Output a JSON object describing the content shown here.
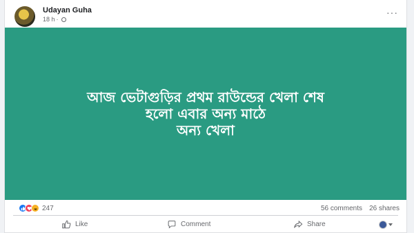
{
  "post": {
    "author": "Udayan Guha",
    "time": "18 h",
    "separator": "·",
    "more_label": "···",
    "banner": {
      "background": "#2a9b82",
      "lines": [
        "আজ ভেটাগুড়ির প্রথম রাউন্ডের খেলা শেষ",
        "হলো এবার অন্য মাঠে",
        "অন্য খেলা"
      ]
    },
    "stats": {
      "reactions": "247",
      "comments": "56 comments",
      "shares": "26 shares"
    },
    "actions": {
      "like": "Like",
      "comment": "Comment",
      "share": "Share"
    }
  }
}
